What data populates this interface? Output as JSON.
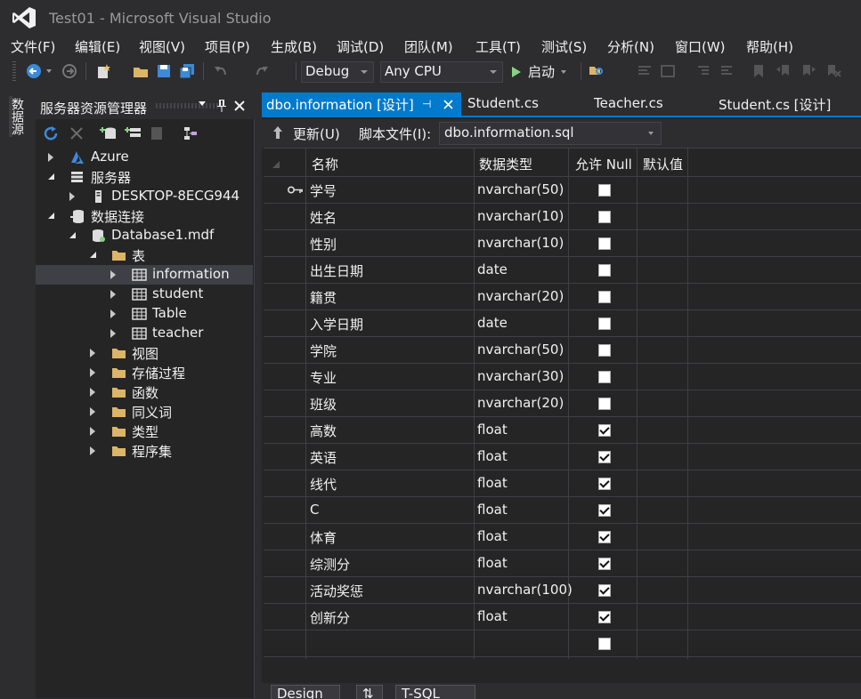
{
  "window": {
    "title": "Test01 - Microsoft Visual Studio"
  },
  "menu": [
    "文件(F)",
    "编辑(E)",
    "视图(V)",
    "项目(P)",
    "生成(B)",
    "调试(D)",
    "团队(M)",
    "工具(T)",
    "测试(S)",
    "分析(N)",
    "窗口(W)",
    "帮助(H)"
  ],
  "toolbar": {
    "config": "Debug",
    "platform": "Any CPU",
    "start_label": "启动"
  },
  "side_tab": {
    "label": "数据源"
  },
  "server_explorer": {
    "title": "服务器资源管理器",
    "nodes": [
      {
        "label": "Azure"
      },
      {
        "label": "服务器"
      },
      {
        "label": "DESKTOP-8ECG944"
      },
      {
        "label": "数据连接"
      },
      {
        "label": "Database1.mdf"
      },
      {
        "label": "表"
      },
      {
        "label": "information"
      },
      {
        "label": "student"
      },
      {
        "label": "Table"
      },
      {
        "label": "teacher"
      },
      {
        "label": "视图"
      },
      {
        "label": "存储过程"
      },
      {
        "label": "函数"
      },
      {
        "label": "同义词"
      },
      {
        "label": "类型"
      },
      {
        "label": "程序集"
      }
    ]
  },
  "tabs": [
    {
      "label": "dbo.information [设计]"
    },
    {
      "label": "Student.cs"
    },
    {
      "label": "Teacher.cs"
    },
    {
      "label": "Student.cs [设计]"
    }
  ],
  "designer": {
    "update_label": "更新(U)",
    "script_label": "脚本文件(I):",
    "script_file": "dbo.information.sql",
    "headers": {
      "name": "名称",
      "type": "数据类型",
      "nullable": "允许 Null",
      "default": "默认值"
    },
    "rows": [
      {
        "name": "学号",
        "type": "nvarchar(50)",
        "nullable": false,
        "key": true
      },
      {
        "name": "姓名",
        "type": "nvarchar(10)",
        "nullable": false
      },
      {
        "name": "性别",
        "type": "nvarchar(10)",
        "nullable": false
      },
      {
        "name": "出生日期",
        "type": "date",
        "nullable": false
      },
      {
        "name": "籍贯",
        "type": "nvarchar(20)",
        "nullable": false
      },
      {
        "name": "入学日期",
        "type": "date",
        "nullable": false
      },
      {
        "name": "学院",
        "type": "nvarchar(50)",
        "nullable": false
      },
      {
        "name": "专业",
        "type": "nvarchar(30)",
        "nullable": false
      },
      {
        "name": "班级",
        "type": "nvarchar(20)",
        "nullable": false
      },
      {
        "name": "高数",
        "type": "float",
        "nullable": true
      },
      {
        "name": "英语",
        "type": "float",
        "nullable": true
      },
      {
        "name": "线代",
        "type": "float",
        "nullable": true
      },
      {
        "name": "C",
        "type": "float",
        "nullable": true
      },
      {
        "name": "体育",
        "type": "float",
        "nullable": true
      },
      {
        "name": "综测分",
        "type": "float",
        "nullable": true
      },
      {
        "name": "活动奖惩",
        "type": "nvarchar(100)",
        "nullable": true
      },
      {
        "name": "创新分",
        "type": "float",
        "nullable": true
      },
      {
        "name": "",
        "type": "",
        "nullable": false
      }
    ]
  },
  "bottom_tabs": [
    "Design",
    "T-SQL"
  ],
  "colors": {
    "accent": "#007acc",
    "background": "#2d2d30",
    "panel": "#252526"
  }
}
